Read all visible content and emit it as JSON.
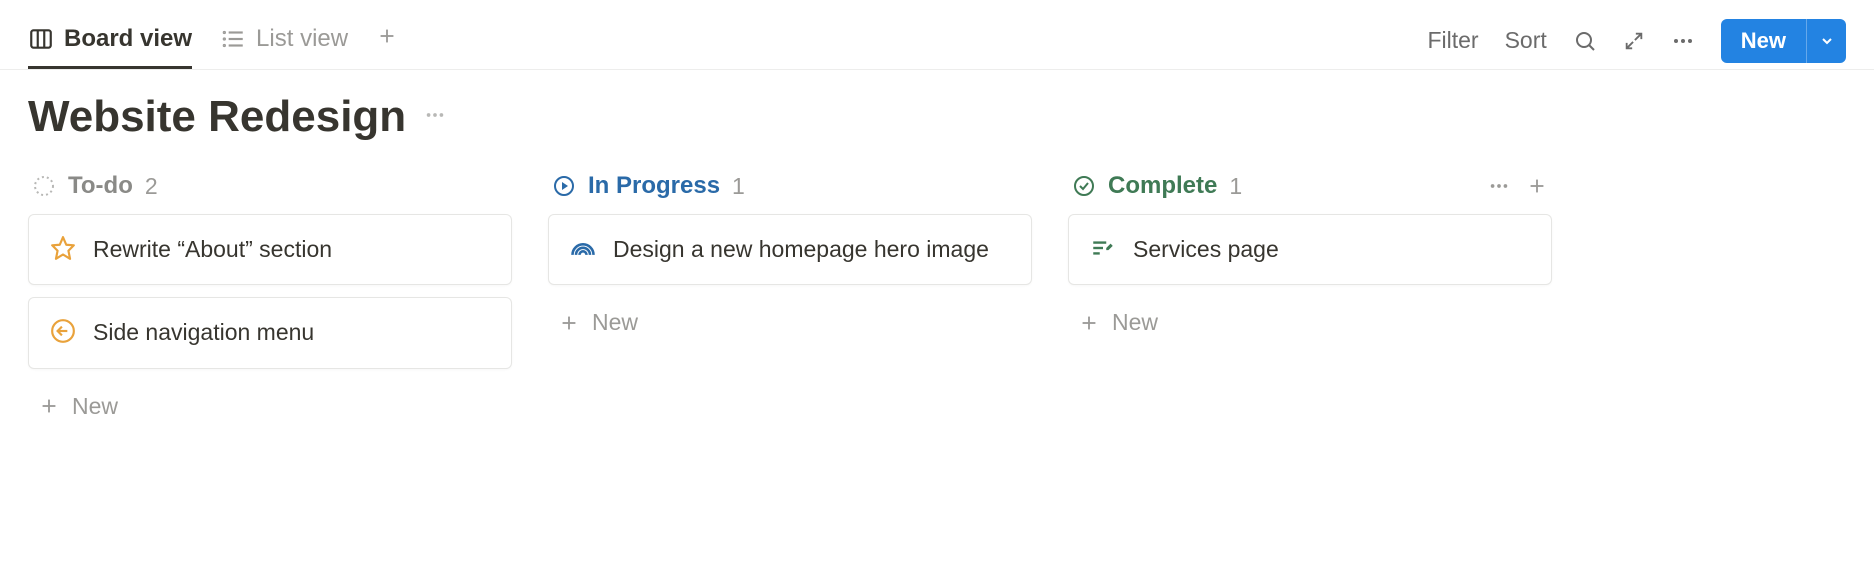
{
  "toolbar": {
    "views": [
      {
        "label": "Board view",
        "active": true
      },
      {
        "label": "List view",
        "active": false
      }
    ],
    "filter_label": "Filter",
    "sort_label": "Sort",
    "new_label": "New"
  },
  "page": {
    "title": "Website Redesign"
  },
  "columns": [
    {
      "id": "todo",
      "name": "To-do",
      "count": "2",
      "show_actions": false,
      "cards": [
        {
          "icon": "star",
          "title": "Rewrite “About” section"
        },
        {
          "icon": "arrow-circle",
          "title": "Side navigation menu"
        }
      ],
      "new_label": "New"
    },
    {
      "id": "in-progress",
      "name": "In Progress",
      "count": "1",
      "show_actions": false,
      "cards": [
        {
          "icon": "rainbow",
          "title": "Design a new homepage hero image"
        }
      ],
      "new_label": "New"
    },
    {
      "id": "complete",
      "name": "Complete",
      "count": "1",
      "show_actions": true,
      "cards": [
        {
          "icon": "edit-lines",
          "title": "Services page"
        }
      ],
      "new_label": "New"
    }
  ]
}
